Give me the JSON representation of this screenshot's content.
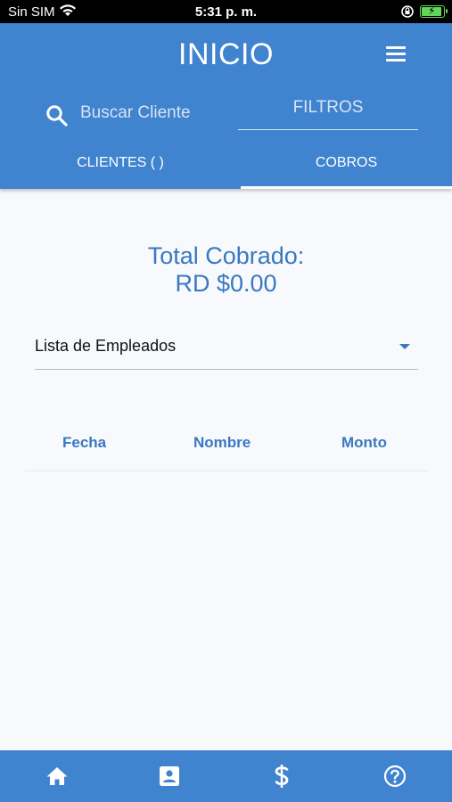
{
  "status_bar": {
    "carrier": "Sin SIM",
    "time": "5:31 p. m.",
    "wifi_icon": "wifi-icon",
    "rotation_lock_icon": "rotation-lock-icon",
    "battery_icon": "battery-charging-icon",
    "battery_color": "#62d65a"
  },
  "header": {
    "title": "INICIO",
    "menu_icon": "hamburger-menu-icon",
    "search_icon": "search-icon",
    "search_placeholder": "Buscar Cliente",
    "filters_label": "FILTROS",
    "background": "#4083cf"
  },
  "tabs": [
    {
      "label": "CLIENTES ( )",
      "selected": false
    },
    {
      "label": "COBROS",
      "selected": true
    }
  ],
  "summary": {
    "total_label": "Total Cobrado:",
    "total_value": "RD $0.00",
    "accent": "#3a78c0"
  },
  "employee_select": {
    "selected": "Lista de Empleados",
    "icon": "dropdown-caret-icon"
  },
  "table": {
    "columns": [
      "Fecha",
      "Nombre",
      "Monto"
    ],
    "rows": []
  },
  "bottom_nav": [
    {
      "icon": "home-icon"
    },
    {
      "icon": "contact-card-icon"
    },
    {
      "icon": "dollar-icon"
    },
    {
      "icon": "help-icon"
    }
  ]
}
